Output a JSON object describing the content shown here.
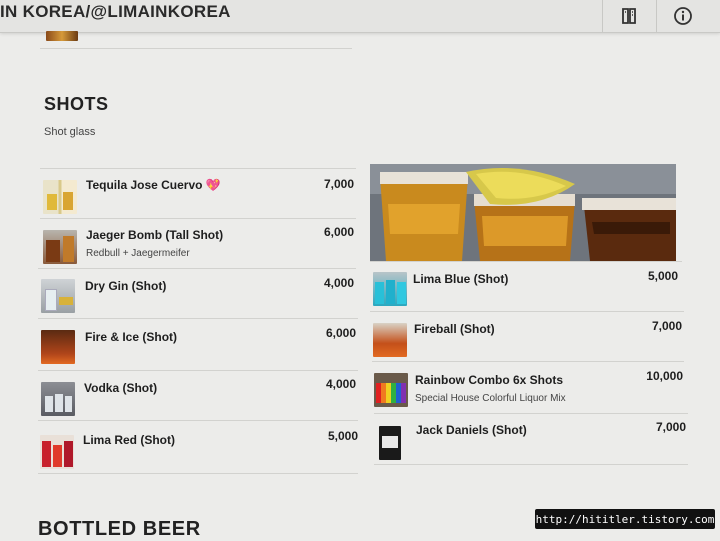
{
  "header": {
    "title": "IN KOREA/@LIMAINKOREA",
    "menu_icon": "menu-book-icon",
    "info_icon": "info-icon"
  },
  "section": {
    "title": "SHOTS",
    "subtitle": "Shot glass"
  },
  "left_items": [
    {
      "name": "Tequila Jose Cuervo 💖",
      "desc": "",
      "price": "7,000"
    },
    {
      "name": "Jaeger Bomb (Tall Shot)",
      "desc": "Redbull + Jaegermeifer",
      "price": "6,000"
    },
    {
      "name": "Dry Gin (Shot)",
      "desc": "",
      "price": "4,000"
    },
    {
      "name": "Fire & Ice (Shot)",
      "desc": "",
      "price": "6,000"
    },
    {
      "name": "Vodka (Shot)",
      "desc": "",
      "price": "4,000"
    },
    {
      "name": "Lima Red (Shot)",
      "desc": "",
      "price": "5,000"
    }
  ],
  "right_items": [
    {
      "name": "Lima Blue (Shot)",
      "desc": "",
      "price": "5,000"
    },
    {
      "name": "Fireball (Shot)",
      "desc": "",
      "price": "7,000"
    },
    {
      "name": "Rainbow Combo 6x Shots",
      "desc": "Special House Colorful Liquor Mix",
      "price": "10,000"
    },
    {
      "name": "Jack Daniels (Shot)",
      "desc": "",
      "price": "7,000"
    }
  ],
  "next_section": {
    "title": "BOTTLED BEER"
  },
  "watermark": "http://hititler.tistory.com"
}
